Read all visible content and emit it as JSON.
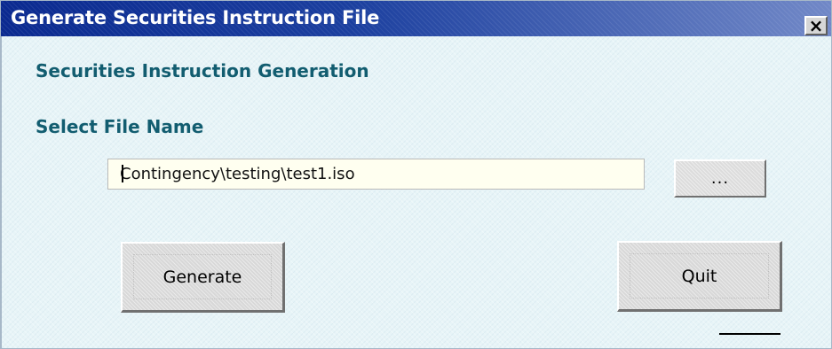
{
  "window": {
    "title": "Generate Securities Instruction File",
    "close_label": "×"
  },
  "form": {
    "section_title": "Securities Instruction Generation",
    "select_file_label": "Select File Name",
    "file_name_value": "Contingency\\testing\\test1.iso",
    "browse_label": "..."
  },
  "actions": {
    "generate_label": "Generate",
    "quit_label": "Quit"
  },
  "icons": {
    "close": "close-icon"
  },
  "colors": {
    "title_bar": "#0b2a90",
    "heading_text": "#125d70",
    "input_background": "#fffff0",
    "button_background": "#d8d8d8"
  }
}
